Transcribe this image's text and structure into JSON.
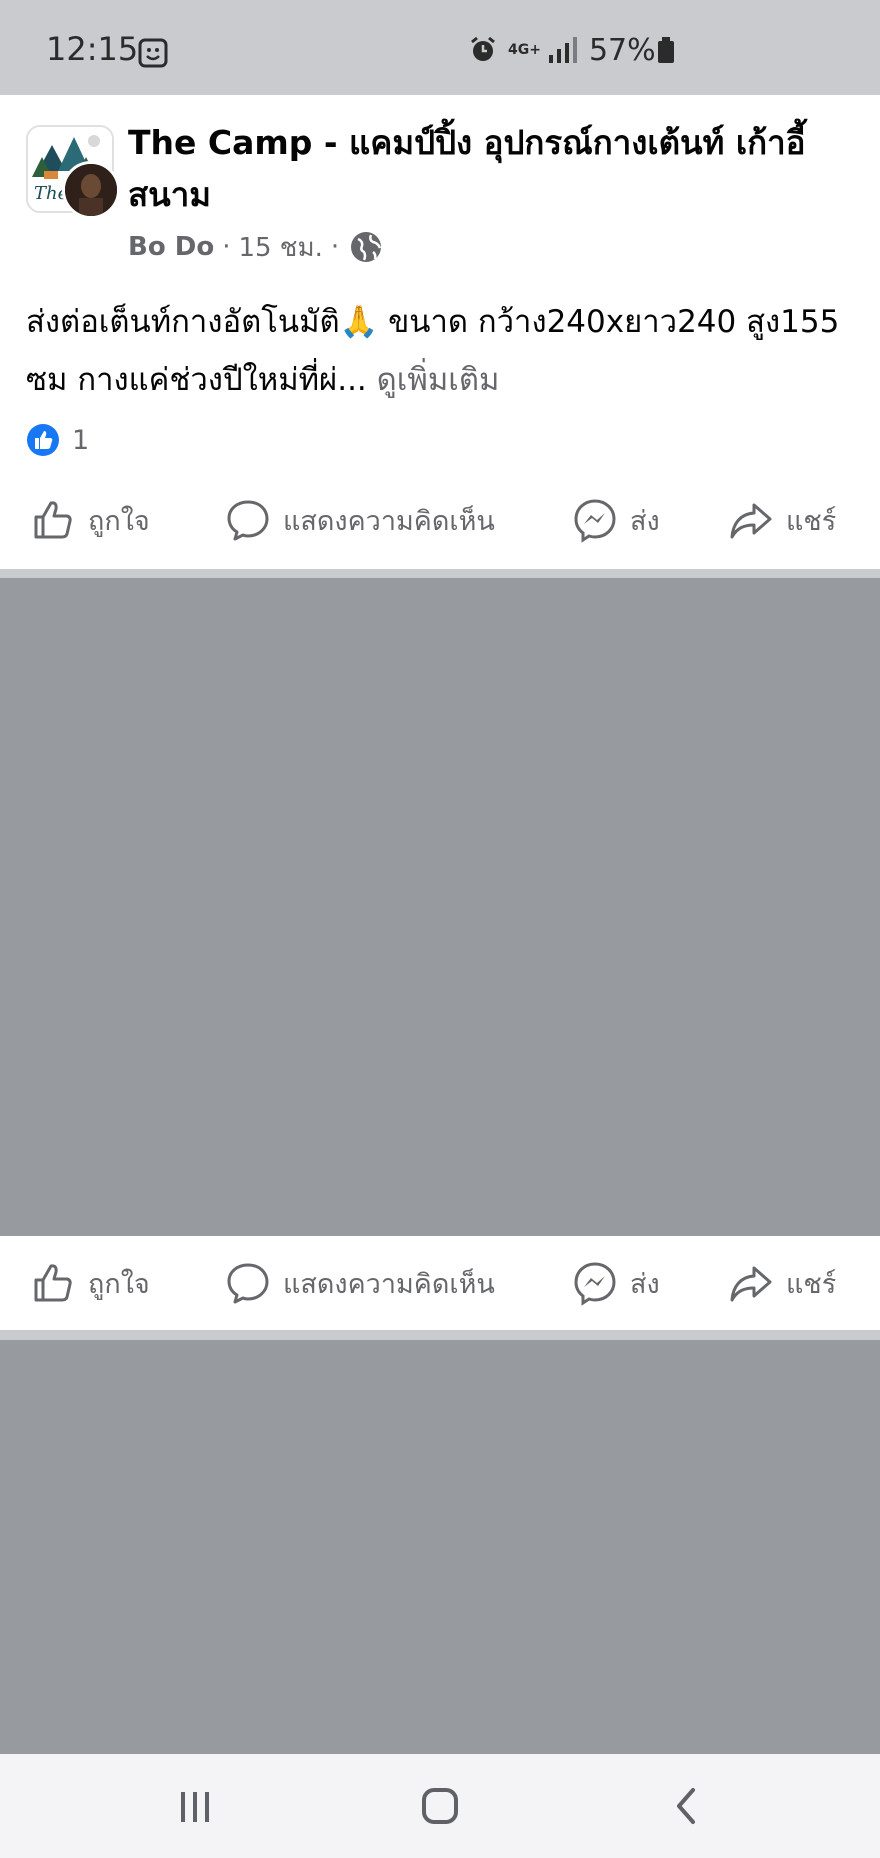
{
  "status_bar": {
    "time": "12:15",
    "network": "4G+",
    "battery": "57%"
  },
  "post": {
    "page_name": "The Camp - แคมป์ปิ้ง อุปกรณ์กางเต้นท์ เก้าอี้สนาม",
    "author": "Bo Do",
    "time_ago": "15 ชม.",
    "separator": "·",
    "text": "ส่งต่อเต็นท์กางอัตโนมัติ🙏 ขนาด กว้าง240xยาว240 สูง155 ซม กางแค่ช่วงปีใหม่ที่ผ่...",
    "see_more": "ดูเพิ่มเติม",
    "reaction_count": "1"
  },
  "actions": {
    "like": "ถูกใจ",
    "comment": "แสดงความคิดเห็น",
    "send": "ส่ง",
    "share": "แชร์"
  },
  "icons": {
    "like": "thumbs-up-icon",
    "comment": "comment-bubble-icon",
    "send": "messenger-icon",
    "share": "share-arrow-icon",
    "privacy": "globe-icon",
    "nav_recents": "recents-icon",
    "nav_home": "home-icon",
    "nav_back": "back-icon"
  },
  "colors": {
    "status_bar_bg": "#c9cbcf",
    "media_placeholder": "#979a9f",
    "secondary_text": "#65676b",
    "like_blue": "#1877f2"
  }
}
